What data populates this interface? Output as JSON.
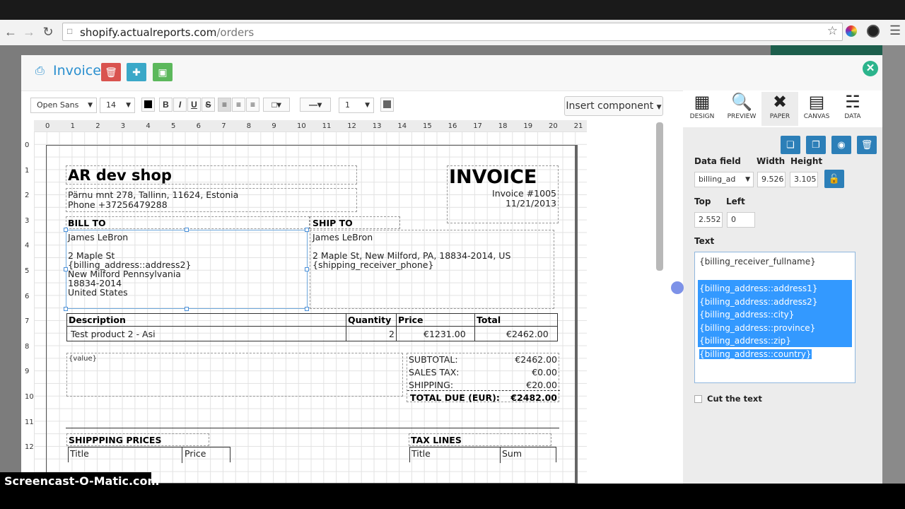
{
  "browser": {
    "url_host": "shopify.actualreports.com",
    "url_path": "/orders"
  },
  "modal": {
    "title": "Invoice"
  },
  "format_toolbar": {
    "font_family": "Open Sans",
    "font_size": "14",
    "bold": "B",
    "italic": "I",
    "underline": "U",
    "strike": "S",
    "line_width": "1",
    "insert_component": "Insert component"
  },
  "ruler": {
    "top": [
      "0",
      "1",
      "2",
      "3",
      "4",
      "5",
      "6",
      "7",
      "8",
      "9",
      "10",
      "11",
      "12",
      "13",
      "14",
      "15",
      "16",
      "17",
      "18",
      "19",
      "20",
      "21"
    ],
    "left": [
      "0",
      "1",
      "2",
      "3",
      "4",
      "5",
      "6",
      "7",
      "8",
      "9",
      "10",
      "11",
      "12"
    ]
  },
  "invoice": {
    "shop_name": "AR dev shop",
    "address_line": "Pärnu mnt 278, Tallinn, 11624, Estonia",
    "phone_line": "Phone +37256479288",
    "title": "INVOICE",
    "number": "Invoice #1005",
    "date": "11/21/2013",
    "bill_to_label": "BILL TO",
    "ship_to_label": "SHIP TO",
    "bill_name": "James LeBron",
    "bill_lines": [
      "2 Maple St",
      "{billing_address::address2}",
      "New Milford Pennsylvania",
      "18834-2014",
      "United States"
    ],
    "ship_name": "James LeBron",
    "ship_lines": [
      "2 Maple St, New Milford, PA, 18834-2014, US",
      "{shipping_receiver_phone}"
    ],
    "table_headers": [
      "Description",
      "Quantity",
      "Price",
      "Total"
    ],
    "table_row": [
      "Test product 2 - Asi",
      "2",
      "€1231.00",
      "€2462.00"
    ],
    "value_placeholder": "{value}",
    "subtotal_label": "SUBTOTAL:",
    "subtotal_value": "€2462.00",
    "tax_label": "SALES TAX:",
    "tax_value": "€0.00",
    "shipping_label": "SHIPPING:",
    "shipping_value": "€20.00",
    "total_label": "TOTAL DUE (EUR):",
    "total_value": "€2482.00",
    "shipping_prices_label": "SHIPPPING PRICES",
    "shipping_prices_cols": [
      "Title",
      "Price"
    ],
    "tax_lines_label": "TAX LINES",
    "tax_lines_cols": [
      "Title",
      "Sum"
    ]
  },
  "panel": {
    "tabs": [
      {
        "label": "DESIGN",
        "icon": "design-icon"
      },
      {
        "label": "PREVIEW",
        "icon": "preview-icon"
      },
      {
        "label": "PAPER",
        "icon": "paper-icon"
      },
      {
        "label": "CANVAS",
        "icon": "canvas-icon"
      },
      {
        "label": "DATA",
        "icon": "data-icon"
      }
    ],
    "data_field_label": "Data field",
    "data_field_value": "billing_ad",
    "width_label": "Width",
    "width_value": "9.526",
    "height_label": "Height",
    "height_value": "3.105",
    "top_label": "Top",
    "top_value": "2.552",
    "left_label": "Left",
    "left_value": "0",
    "text_label": "Text",
    "text_first": "{billing_receiver_fullname}",
    "text_selected": [
      "{billing_address::address1}",
      "{billing_address::address2}",
      "{billing_address::city}",
      "{billing_address::province}",
      "{billing_address::zip}",
      "{billing_address::country}"
    ],
    "cut_text_label": "Cut the text"
  },
  "watermark": "Screencast-O-Matic.com",
  "colors": {
    "accent": "#2a8fcf",
    "delete_red": "#d9534f",
    "add_blue": "#3aa8c8",
    "save_green": "#5cb85c",
    "panel_btn": "#2c7fb8",
    "close_green": "#2cb48c",
    "selection": "#3399ff"
  }
}
